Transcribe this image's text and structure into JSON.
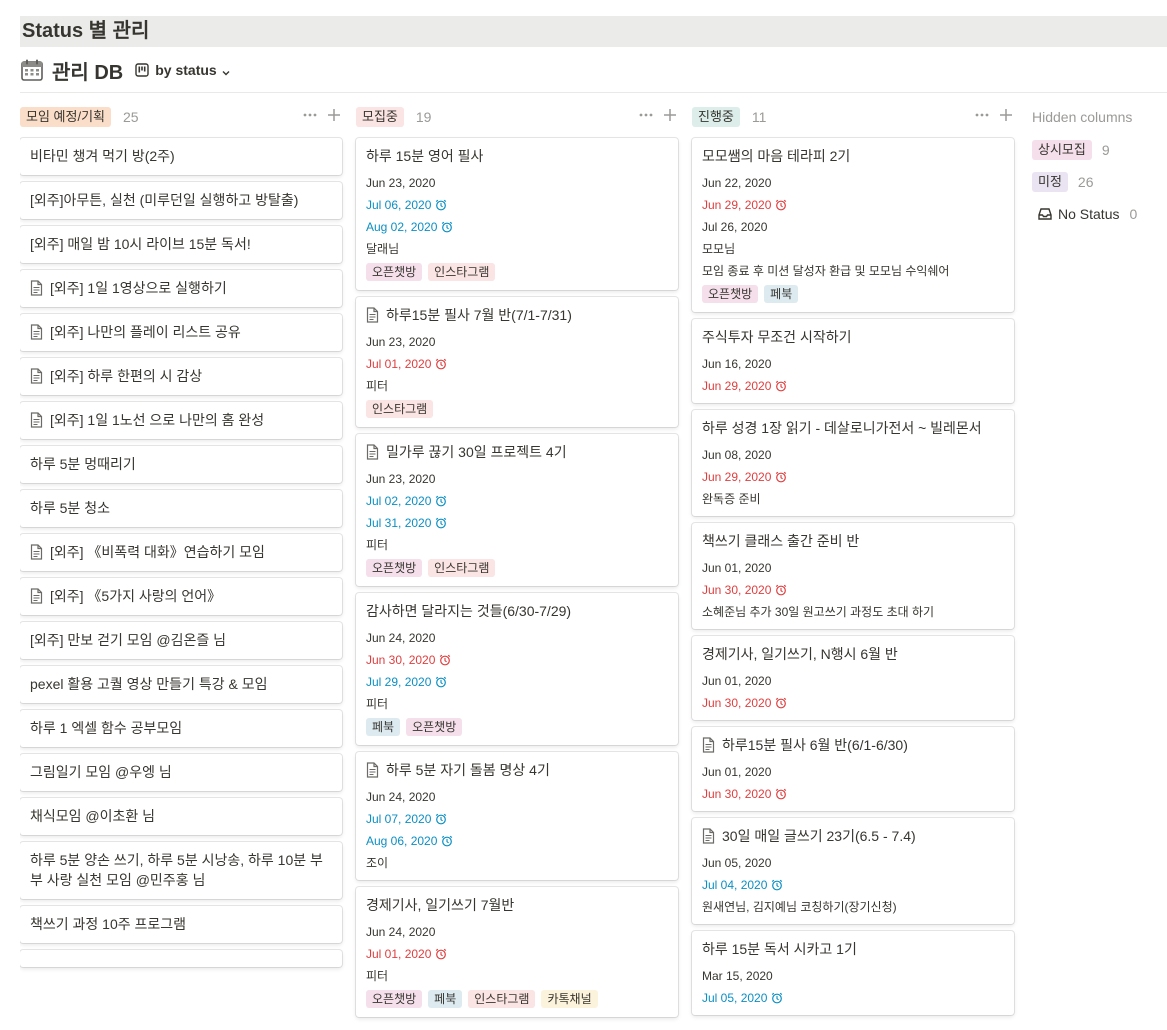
{
  "page": {
    "title": "Status 별 관리"
  },
  "database": {
    "title": "관리 DB",
    "view_label": "by status"
  },
  "colors": {
    "pill_planning": "#fadec9",
    "pill_recruiting": "#fbe4e4",
    "pill_progress": "#ddedea",
    "pill_always": "#f4dfeb",
    "pill_undecided": "#eae4f2",
    "tag_openchat": "#f4dfeb",
    "tag_instagram": "#fbe4e4",
    "tag_facebook": "#ddebf1",
    "tag_kakao": "#fbf3db"
  },
  "columns": [
    {
      "name": "모임 예정/기획",
      "count": "25",
      "color": "#fadec9",
      "cards": [
        {
          "title": "비타민 챙겨 먹기 방(2주)",
          "page_icon": false
        },
        {
          "title": "[외주]아무튼, 실천 (미루던일 실행하고 방탈출)",
          "page_icon": false
        },
        {
          "title": "[외주] 매일 밤 10시 라이브 15분 독서!",
          "page_icon": false
        },
        {
          "title": "[외주] 1일 1영상으로 실행하기",
          "page_icon": true
        },
        {
          "title": "[외주] 나만의 플레이 리스트 공유",
          "page_icon": true
        },
        {
          "title": "[외주] 하루 한편의 시 감상",
          "page_icon": true
        },
        {
          "title": "[외주] 1일 1노선 으로 나만의 홈 완성",
          "page_icon": true
        },
        {
          "title": "하루 5분 멍때리기",
          "page_icon": false
        },
        {
          "title": "하루 5분 청소",
          "page_icon": false
        },
        {
          "title": "[외주] 《비폭력 대화》연습하기 모임",
          "page_icon": true
        },
        {
          "title": "[외주] 《5가지 사랑의 언어》",
          "page_icon": true
        },
        {
          "title": "[외주] 만보 걷기 모임 @김온즐 님",
          "page_icon": false
        },
        {
          "title": "pexel 활용 고퀄 영상 만들기 특강 & 모임",
          "page_icon": false
        },
        {
          "title": "하루 1 엑셀 함수 공부모임",
          "page_icon": false
        },
        {
          "title": "그림일기 모임 @우엥 님",
          "page_icon": false
        },
        {
          "title": "채식모임 @이초환 님",
          "page_icon": false
        },
        {
          "title": "하루 5분 양손 쓰기, 하루 5분 시낭송, 하루 10분 부부 사랑 실천 모임 @민주홍 님",
          "page_icon": false
        },
        {
          "title": "책쓰기 과정 10주 프로그램",
          "page_icon": false
        },
        {
          "title": "",
          "page_icon": false
        }
      ]
    },
    {
      "name": "모집중",
      "count": "19",
      "color": "#fbe4e4",
      "cards": [
        {
          "title": "하루 15분 영어 필사",
          "page_icon": false,
          "props": [
            {
              "text": "Jun 23, 2020",
              "color": "normal"
            },
            {
              "text": "Jul 06, 2020",
              "color": "blue",
              "alarm": true
            },
            {
              "text": "Aug 02, 2020",
              "color": "blue",
              "alarm": true
            },
            {
              "text": "달래님",
              "color": "normal"
            }
          ],
          "tags": [
            "오픈챗방",
            "인스타그램"
          ]
        },
        {
          "title": "하루15분 필사 7월 반(7/1-7/31)",
          "page_icon": true,
          "props": [
            {
              "text": "Jun 23, 2020",
              "color": "normal"
            },
            {
              "text": "Jul 01, 2020",
              "color": "red",
              "alarm": true
            },
            {
              "text": "피터",
              "color": "normal"
            }
          ],
          "tags": [
            "인스타그램"
          ]
        },
        {
          "title": "밀가루 끊기 30일 프로젝트 4기",
          "page_icon": true,
          "props": [
            {
              "text": "Jun 23, 2020",
              "color": "normal"
            },
            {
              "text": "Jul 02, 2020",
              "color": "blue",
              "alarm": true
            },
            {
              "text": "Jul 31, 2020",
              "color": "blue",
              "alarm": true
            },
            {
              "text": "피터",
              "color": "normal"
            }
          ],
          "tags": [
            "오픈챗방",
            "인스타그램"
          ]
        },
        {
          "title": "감사하면 달라지는 것들(6/30-7/29)",
          "page_icon": false,
          "props": [
            {
              "text": "Jun 24, 2020",
              "color": "normal"
            },
            {
              "text": "Jun 30, 2020",
              "color": "red",
              "alarm": true
            },
            {
              "text": "Jul 29, 2020",
              "color": "blue",
              "alarm": true
            },
            {
              "text": "피터",
              "color": "normal"
            }
          ],
          "tags": [
            "페북",
            "오픈챗방"
          ]
        },
        {
          "title": "하루 5분 자기 돌봄 명상 4기",
          "page_icon": true,
          "props": [
            {
              "text": "Jun 24, 2020",
              "color": "normal"
            },
            {
              "text": "Jul 07, 2020",
              "color": "blue",
              "alarm": true
            },
            {
              "text": "Aug 06, 2020",
              "color": "blue",
              "alarm": true
            },
            {
              "text": "조이",
              "color": "normal"
            }
          ],
          "tags": []
        },
        {
          "title": "경제기사, 일기쓰기 7월반",
          "page_icon": false,
          "props": [
            {
              "text": "Jun 24, 2020",
              "color": "normal"
            },
            {
              "text": "Jul 01, 2020",
              "color": "red",
              "alarm": true
            },
            {
              "text": "피터",
              "color": "normal"
            }
          ],
          "tags": [
            "오픈챗방",
            "페북",
            "인스타그램",
            "카톡채널"
          ]
        }
      ]
    },
    {
      "name": "진행중",
      "count": "11",
      "color": "#ddedea",
      "cards": [
        {
          "title": "모모쌤의 마음 테라피 2기",
          "page_icon": false,
          "props": [
            {
              "text": "Jun 22, 2020",
              "color": "normal"
            },
            {
              "text": "Jun 29, 2020",
              "color": "red",
              "alarm": true
            },
            {
              "text": "Jul 26, 2020",
              "color": "normal"
            },
            {
              "text": "모모님",
              "color": "normal"
            },
            {
              "text": "모임 종료 후 미션 달성자 환급 및 모모님 수익쉐어",
              "color": "normal"
            }
          ],
          "tags": [
            "오픈챗방",
            "페북"
          ]
        },
        {
          "title": "주식투자 무조건 시작하기",
          "page_icon": false,
          "props": [
            {
              "text": "Jun 16, 2020",
              "color": "normal"
            },
            {
              "text": "Jun 29, 2020",
              "color": "red",
              "alarm": true
            }
          ],
          "tags": []
        },
        {
          "title": "하루 성경 1장 읽기 - 데살로니가전서 ~ 빌레몬서",
          "page_icon": false,
          "props": [
            {
              "text": "Jun 08, 2020",
              "color": "normal"
            },
            {
              "text": "Jun 29, 2020",
              "color": "red",
              "alarm": true
            },
            {
              "text": "완독증 준비",
              "color": "normal"
            }
          ],
          "tags": []
        },
        {
          "title": "책쓰기 클래스 출간 준비 반",
          "page_icon": false,
          "props": [
            {
              "text": "Jun 01, 2020",
              "color": "normal"
            },
            {
              "text": "Jun 30, 2020",
              "color": "red",
              "alarm": true
            },
            {
              "text": "소혜준님 추가 30일 원고쓰기 과정도 초대 하기",
              "color": "normal"
            }
          ],
          "tags": []
        },
        {
          "title": "경제기사, 일기쓰기, N행시 6월 반",
          "page_icon": false,
          "props": [
            {
              "text": "Jun 01, 2020",
              "color": "normal"
            },
            {
              "text": "Jun 30, 2020",
              "color": "red",
              "alarm": true
            }
          ],
          "tags": []
        },
        {
          "title": "하루15분 필사 6월 반(6/1-6/30)",
          "page_icon": true,
          "props": [
            {
              "text": "Jun 01, 2020",
              "color": "normal"
            },
            {
              "text": "Jun 30, 2020",
              "color": "red",
              "alarm": true
            }
          ],
          "tags": []
        },
        {
          "title": "30일 매일 글쓰기 23기(6.5 - 7.4)",
          "page_icon": true,
          "props": [
            {
              "text": "Jun 05, 2020",
              "color": "normal"
            },
            {
              "text": "Jul 04, 2020",
              "color": "blue",
              "alarm": true
            },
            {
              "text": "원새연님, 김지예님 코칭하기(장기신청)",
              "color": "normal"
            }
          ],
          "tags": []
        },
        {
          "title": "하루 15분 독서 시카고 1기",
          "page_icon": false,
          "props": [
            {
              "text": "Mar 15, 2020",
              "color": "normal"
            },
            {
              "text": "Jul 05, 2020",
              "color": "blue",
              "alarm": true
            }
          ],
          "tags": []
        }
      ]
    }
  ],
  "hidden": {
    "title": "Hidden columns",
    "items": [
      {
        "name": "상시모집",
        "count": "9",
        "color": "#f4dfeb"
      },
      {
        "name": "미정",
        "count": "26",
        "color": "#eae4f2"
      }
    ],
    "no_status": {
      "name": "No Status",
      "count": "0"
    }
  }
}
